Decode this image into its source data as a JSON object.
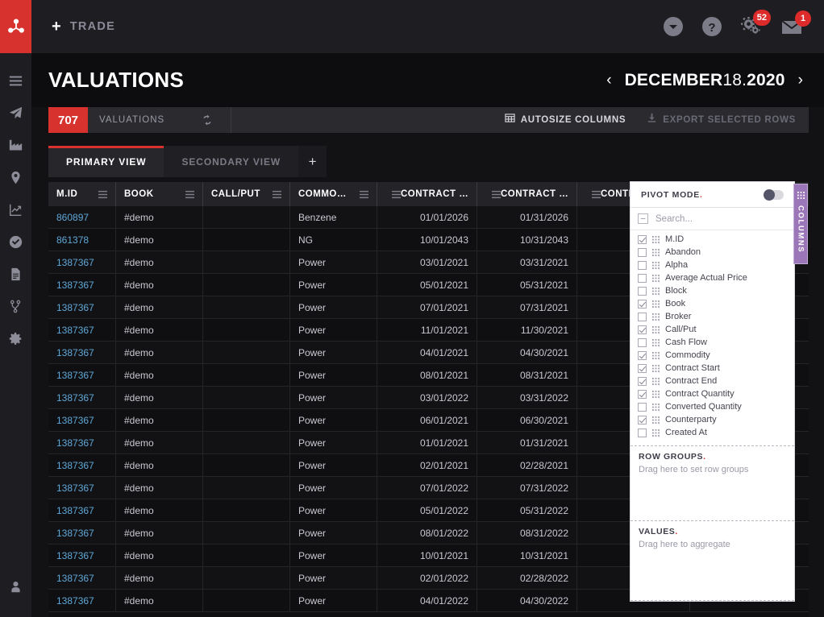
{
  "rail": {
    "logo_name": "molecule-logo",
    "items": [
      {
        "name": "menu-icon",
        "label": "Menu"
      },
      {
        "name": "paper-plane-icon",
        "label": "Trades"
      },
      {
        "name": "factory-icon",
        "label": "Assets"
      },
      {
        "name": "location-pin-icon",
        "label": "Locations"
      },
      {
        "name": "line-chart-icon",
        "label": "Analytics"
      },
      {
        "name": "check-circle-icon",
        "label": "Approvals"
      },
      {
        "name": "document-icon",
        "label": "Reports"
      },
      {
        "name": "branch-icon",
        "label": "Workflows"
      },
      {
        "name": "gear-icon",
        "label": "Settings"
      }
    ],
    "bottom": {
      "name": "user-icon",
      "label": "Account"
    }
  },
  "topbar": {
    "trade_plus": "+",
    "trade_label": "TRADE",
    "icons": [
      {
        "name": "chevron-down-circle-icon",
        "badge": null
      },
      {
        "name": "help-circle-icon",
        "badge": null
      },
      {
        "name": "gears-icon",
        "badge": "52"
      },
      {
        "name": "envelope-icon",
        "badge": "1"
      }
    ]
  },
  "page": {
    "title": "VALUATIONS",
    "date": {
      "prev": "‹",
      "next": "›",
      "month": "DECEMBER",
      "day": "18.",
      "year": "2020"
    }
  },
  "countbar": {
    "count": "707",
    "count_label": "VALUATIONS",
    "refresh_icon": "refresh-icon",
    "autosize_label": "AUTOSIZE COLUMNS",
    "autosize_icon": "table-icon",
    "export_label": "EXPORT SELECTED ROWS",
    "export_icon": "download-icon"
  },
  "tabs": {
    "primary": "PRIMARY VIEW",
    "secondary": "SECONDARY VIEW",
    "add": "+"
  },
  "grid": {
    "columns": [
      {
        "label": "M.ID",
        "width": 84,
        "align": "left"
      },
      {
        "label": "BOOK",
        "width": 108,
        "align": "left"
      },
      {
        "label": "CALL/PUT",
        "width": 108,
        "align": "left"
      },
      {
        "label": "COMMODITY",
        "width": 108,
        "align": "left"
      },
      {
        "label": "CONTRACT ST...",
        "width": 124,
        "align": "right"
      },
      {
        "label": "CONTRACT END",
        "width": 124,
        "align": "right"
      },
      {
        "label": "CONTRACT QUANTITY",
        "width": 140,
        "align": "right"
      }
    ],
    "rows": [
      {
        "mid": "860897",
        "book": "#demo",
        "callput": "",
        "commodity": "Benzene",
        "start": "01/01/2026",
        "end": "01/31/2026",
        "qty": ""
      },
      {
        "mid": "861378",
        "book": "#demo",
        "callput": "",
        "commodity": "NG",
        "start": "10/01/2043",
        "end": "10/31/2043",
        "qty": ""
      },
      {
        "mid": "1387367",
        "book": "#demo",
        "callput": "",
        "commodity": "Power",
        "start": "03/01/2021",
        "end": "03/31/2021",
        "qty": ""
      },
      {
        "mid": "1387367",
        "book": "#demo",
        "callput": "",
        "commodity": "Power",
        "start": "05/01/2021",
        "end": "05/31/2021",
        "qty": ""
      },
      {
        "mid": "1387367",
        "book": "#demo",
        "callput": "",
        "commodity": "Power",
        "start": "07/01/2021",
        "end": "07/31/2021",
        "qty": ""
      },
      {
        "mid": "1387367",
        "book": "#demo",
        "callput": "",
        "commodity": "Power",
        "start": "11/01/2021",
        "end": "11/30/2021",
        "qty": ""
      },
      {
        "mid": "1387367",
        "book": "#demo",
        "callput": "",
        "commodity": "Power",
        "start": "04/01/2021",
        "end": "04/30/2021",
        "qty": ""
      },
      {
        "mid": "1387367",
        "book": "#demo",
        "callput": "",
        "commodity": "Power",
        "start": "08/01/2021",
        "end": "08/31/2021",
        "qty": ""
      },
      {
        "mid": "1387367",
        "book": "#demo",
        "callput": "",
        "commodity": "Power",
        "start": "03/01/2022",
        "end": "03/31/2022",
        "qty": ""
      },
      {
        "mid": "1387367",
        "book": "#demo",
        "callput": "",
        "commodity": "Power",
        "start": "06/01/2021",
        "end": "06/30/2021",
        "qty": ""
      },
      {
        "mid": "1387367",
        "book": "#demo",
        "callput": "",
        "commodity": "Power",
        "start": "01/01/2021",
        "end": "01/31/2021",
        "qty": ""
      },
      {
        "mid": "1387367",
        "book": "#demo",
        "callput": "",
        "commodity": "Power",
        "start": "02/01/2021",
        "end": "02/28/2021",
        "qty": ""
      },
      {
        "mid": "1387367",
        "book": "#demo",
        "callput": "",
        "commodity": "Power",
        "start": "07/01/2022",
        "end": "07/31/2022",
        "qty": ""
      },
      {
        "mid": "1387367",
        "book": "#demo",
        "callput": "",
        "commodity": "Power",
        "start": "05/01/2022",
        "end": "05/31/2022",
        "qty": ""
      },
      {
        "mid": "1387367",
        "book": "#demo",
        "callput": "",
        "commodity": "Power",
        "start": "08/01/2022",
        "end": "08/31/2022",
        "qty": ""
      },
      {
        "mid": "1387367",
        "book": "#demo",
        "callput": "",
        "commodity": "Power",
        "start": "10/01/2021",
        "end": "10/31/2021",
        "qty": ""
      },
      {
        "mid": "1387367",
        "book": "#demo",
        "callput": "",
        "commodity": "Power",
        "start": "02/01/2022",
        "end": "02/28/2022",
        "qty": ""
      },
      {
        "mid": "1387367",
        "book": "#demo",
        "callput": "",
        "commodity": "Power",
        "start": "04/01/2022",
        "end": "04/30/2022",
        "qty": ""
      }
    ]
  },
  "pivot": {
    "title": "PIVOT MODE",
    "title_dot": ".",
    "toggle_state": "off",
    "search_placeholder": "Search...",
    "collapse_icon": "collapse-box-icon",
    "columns": [
      {
        "label": "M.ID",
        "checked": true
      },
      {
        "label": "Abandon",
        "checked": false
      },
      {
        "label": "Alpha",
        "checked": false
      },
      {
        "label": "Average Actual Price",
        "checked": false
      },
      {
        "label": "Block",
        "checked": false
      },
      {
        "label": "Book",
        "checked": true
      },
      {
        "label": "Broker",
        "checked": false
      },
      {
        "label": "Call/Put",
        "checked": true
      },
      {
        "label": "Cash Flow",
        "checked": false
      },
      {
        "label": "Commodity",
        "checked": true
      },
      {
        "label": "Contract Start",
        "checked": true
      },
      {
        "label": "Contract End",
        "checked": true
      },
      {
        "label": "Contract Quantity",
        "checked": true
      },
      {
        "label": "Converted Quantity",
        "checked": false
      },
      {
        "label": "Counterparty",
        "checked": true
      },
      {
        "label": "Created At",
        "checked": false
      }
    ],
    "row_groups": {
      "title": "ROW GROUPS",
      "dot": ".",
      "hint": "Drag here to set row groups"
    },
    "values": {
      "title": "VALUES",
      "dot": ".",
      "hint": "Drag here to aggregate"
    },
    "columns_tab_label": "COLUMNS",
    "columns_tab_icon": "grid-icon"
  },
  "colors": {
    "brand_red": "#d8322f",
    "link_blue": "#5fa8d8",
    "pivot_tab_purple": "#9b76b8",
    "panel_bg": "#ffffff",
    "app_bg": "#121214"
  }
}
